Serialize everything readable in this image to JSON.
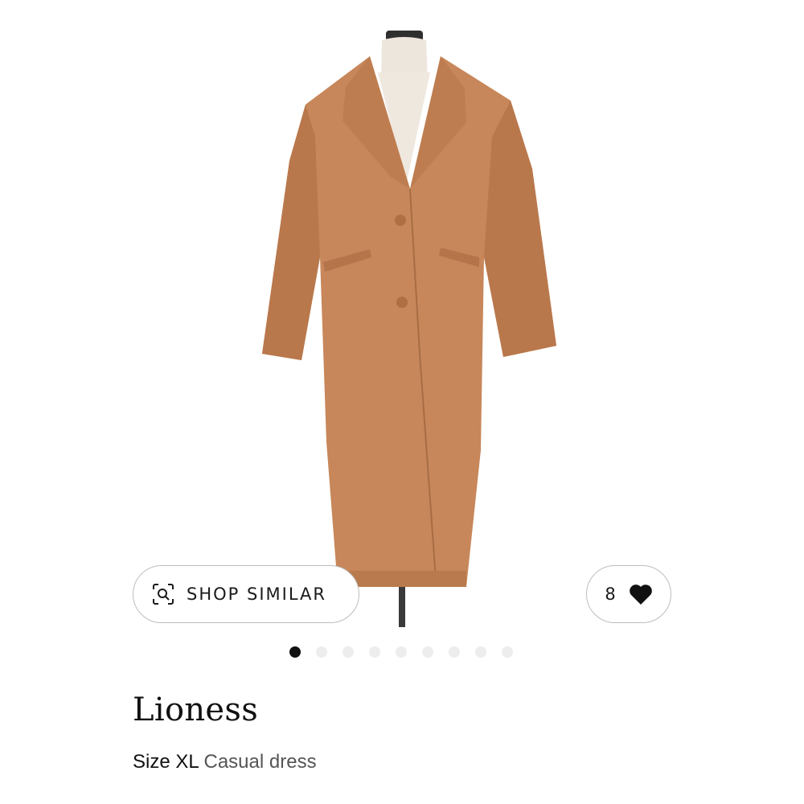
{
  "shop_similar": {
    "label": "SHOP SIMILAR",
    "icon": "camera-search-icon"
  },
  "likes": {
    "count": "8",
    "icon": "heart-icon"
  },
  "pagination": {
    "total": 9,
    "active_index": 0
  },
  "product": {
    "brand": "Lioness",
    "size": "Size XL",
    "category": "Casual dress",
    "image_description_colors": {
      "coat": "#C7875A",
      "coat_shadow": "#A86C44",
      "mannequin": "#EDE6DD",
      "stand": "#3a3a3a"
    }
  },
  "colors": {
    "pill_border": "#bdbdbd",
    "active_dot": "#111111",
    "inactive_dot": "#ededed"
  }
}
